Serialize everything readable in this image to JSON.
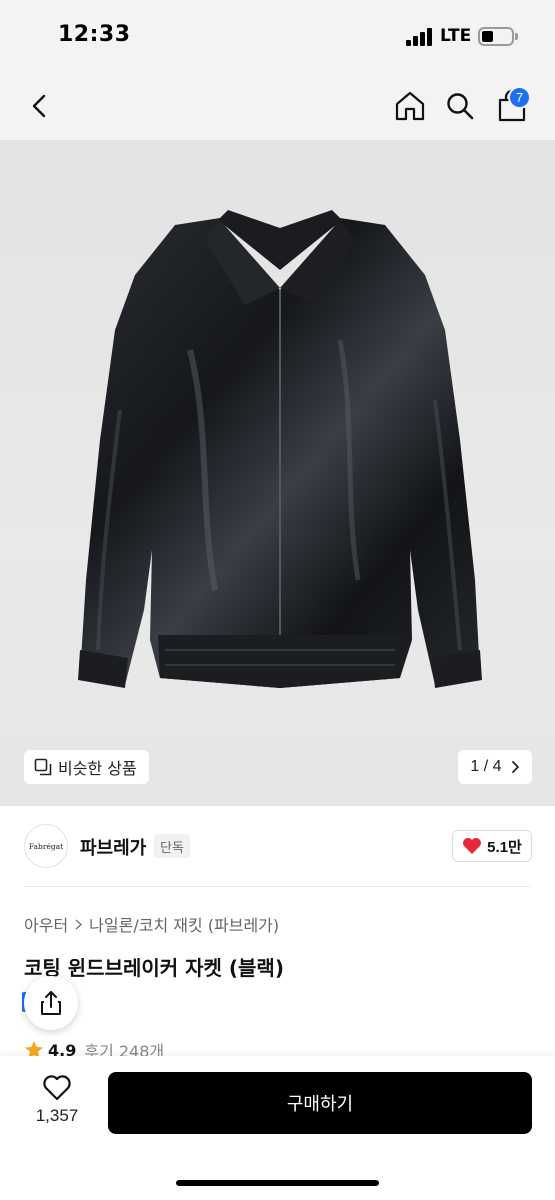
{
  "status_bar": {
    "time": "12:33",
    "network": "LTE"
  },
  "nav": {
    "cart_count": "7"
  },
  "gallery": {
    "similar_label": "비슷한 상품",
    "current_page": "1",
    "total_pages": "4",
    "page_separator": "/"
  },
  "brand": {
    "logo_text": "Fabrégat",
    "name": "파브레가",
    "badge": "단독",
    "likes": "5.1만"
  },
  "product": {
    "breadcrumb": [
      "아우터",
      "나일론/코치 재킷 (파브레가)"
    ],
    "title": "코팅 윈드브레이커 자켓 (블랙)",
    "rating": "4.9",
    "reviews": "후기 248개"
  },
  "bottom_bar": {
    "wish_count": "1,357",
    "buy_label": "구매하기"
  },
  "colors": {
    "accent_blue": "#1e6ff1",
    "heart_red": "#e8283a",
    "star_orange": "#f4a623",
    "buy_button": "#000000"
  }
}
